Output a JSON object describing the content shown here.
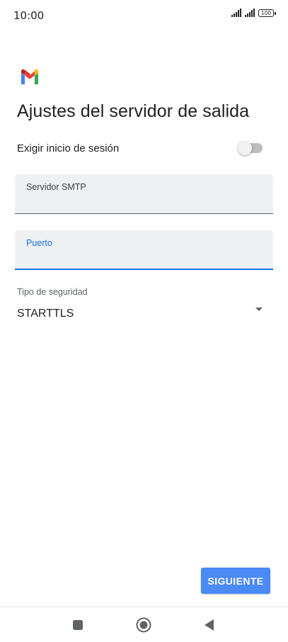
{
  "status_bar": {
    "time": "10:00",
    "battery": "100",
    "icons": [
      "signal-icon",
      "signal-icon",
      "battery-icon"
    ]
  },
  "app": {
    "logo_icon": "gmail-logo-icon"
  },
  "page": {
    "title": "Ajustes del servidor de salida"
  },
  "require_signin": {
    "label": "Exigir inicio de sesión",
    "enabled": false
  },
  "fields": {
    "smtp_server": {
      "label": "Servidor SMTP",
      "value": ""
    },
    "port": {
      "label": "Puerto",
      "value": ""
    }
  },
  "security": {
    "label": "Tipo de seguridad",
    "value": "STARTTLS"
  },
  "actions": {
    "next_label": "SIGUIENTE"
  },
  "nav": {
    "icons": [
      "recents-icon",
      "home-icon",
      "back-icon"
    ]
  },
  "colors": {
    "accent": "#1a73e8",
    "button": "#4a8af4",
    "field_bg": "#eef0f2"
  }
}
